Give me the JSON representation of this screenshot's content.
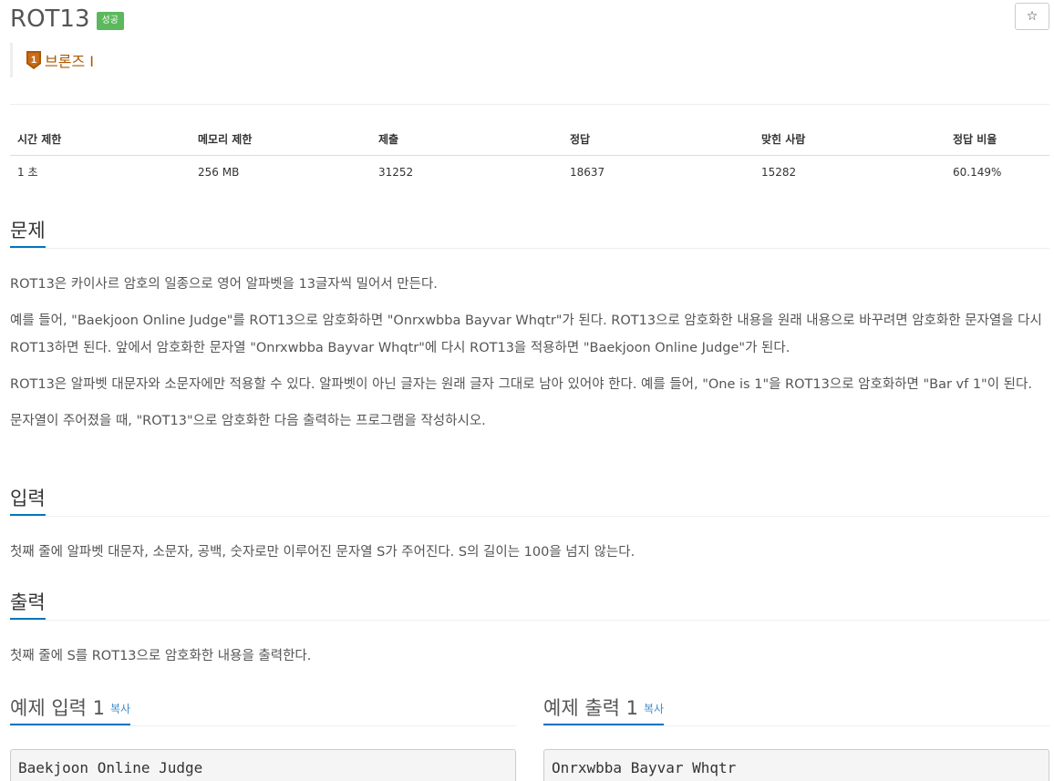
{
  "problem": {
    "title": "ROT13",
    "status_badge": "성공",
    "star_label": "☆",
    "tier": {
      "level": "1",
      "label": "브론즈 I",
      "color": "#ad5600"
    }
  },
  "stats": {
    "headers": [
      "시간 제한",
      "메모리 제한",
      "제출",
      "정답",
      "맞힌 사람",
      "정답 비율"
    ],
    "values": [
      "1 초",
      "256 MB",
      "31252",
      "18637",
      "15282",
      "60.149%"
    ]
  },
  "sections": {
    "problem": {
      "heading": "문제",
      "paragraphs": [
        "ROT13은 카이사르 암호의 일종으로 영어 알파벳을 13글자씩 밀어서 만든다.",
        "예를 들어, \"Baekjoon Online Judge\"를 ROT13으로 암호화하면 \"Onrxwbba Bayvar Whqtr\"가 된다. ROT13으로 암호화한 내용을 원래 내용으로 바꾸려면 암호화한 문자열을 다시 ROT13하면 된다. 앞에서 암호화한 문자열 \"Onrxwbba Bayvar Whqtr\"에 다시 ROT13을 적용하면 \"Baekjoon Online Judge\"가 된다.",
        "ROT13은 알파벳 대문자와 소문자에만 적용할 수 있다. 알파벳이 아닌 글자는 원래 글자 그대로 남아 있어야 한다. 예를 들어, \"One is 1\"을 ROT13으로 암호화하면 \"Bar vf 1\"이 된다.",
        "문자열이 주어졌을 때, \"ROT13\"으로 암호화한 다음 출력하는 프로그램을 작성하시오."
      ]
    },
    "input": {
      "heading": "입력",
      "text": "첫째 줄에 알파벳 대문자, 소문자, 공백, 숫자로만 이루어진 문자열 S가 주어진다. S의 길이는 100을 넘지 않는다."
    },
    "output": {
      "heading": "출력",
      "text": "첫째 줄에 S를 ROT13으로 암호화한 내용을 출력한다."
    }
  },
  "examples": {
    "input": {
      "heading": "예제 입력 1",
      "copy_label": "복사",
      "content": "Baekjoon Online Judge"
    },
    "output": {
      "heading": "예제 출력 1",
      "copy_label": "복사",
      "content": "Onrxwbba Bayvar Whqtr"
    }
  },
  "colors": {
    "accent": "#0076c0",
    "success": "#5cb85c",
    "link": "#428bca"
  }
}
